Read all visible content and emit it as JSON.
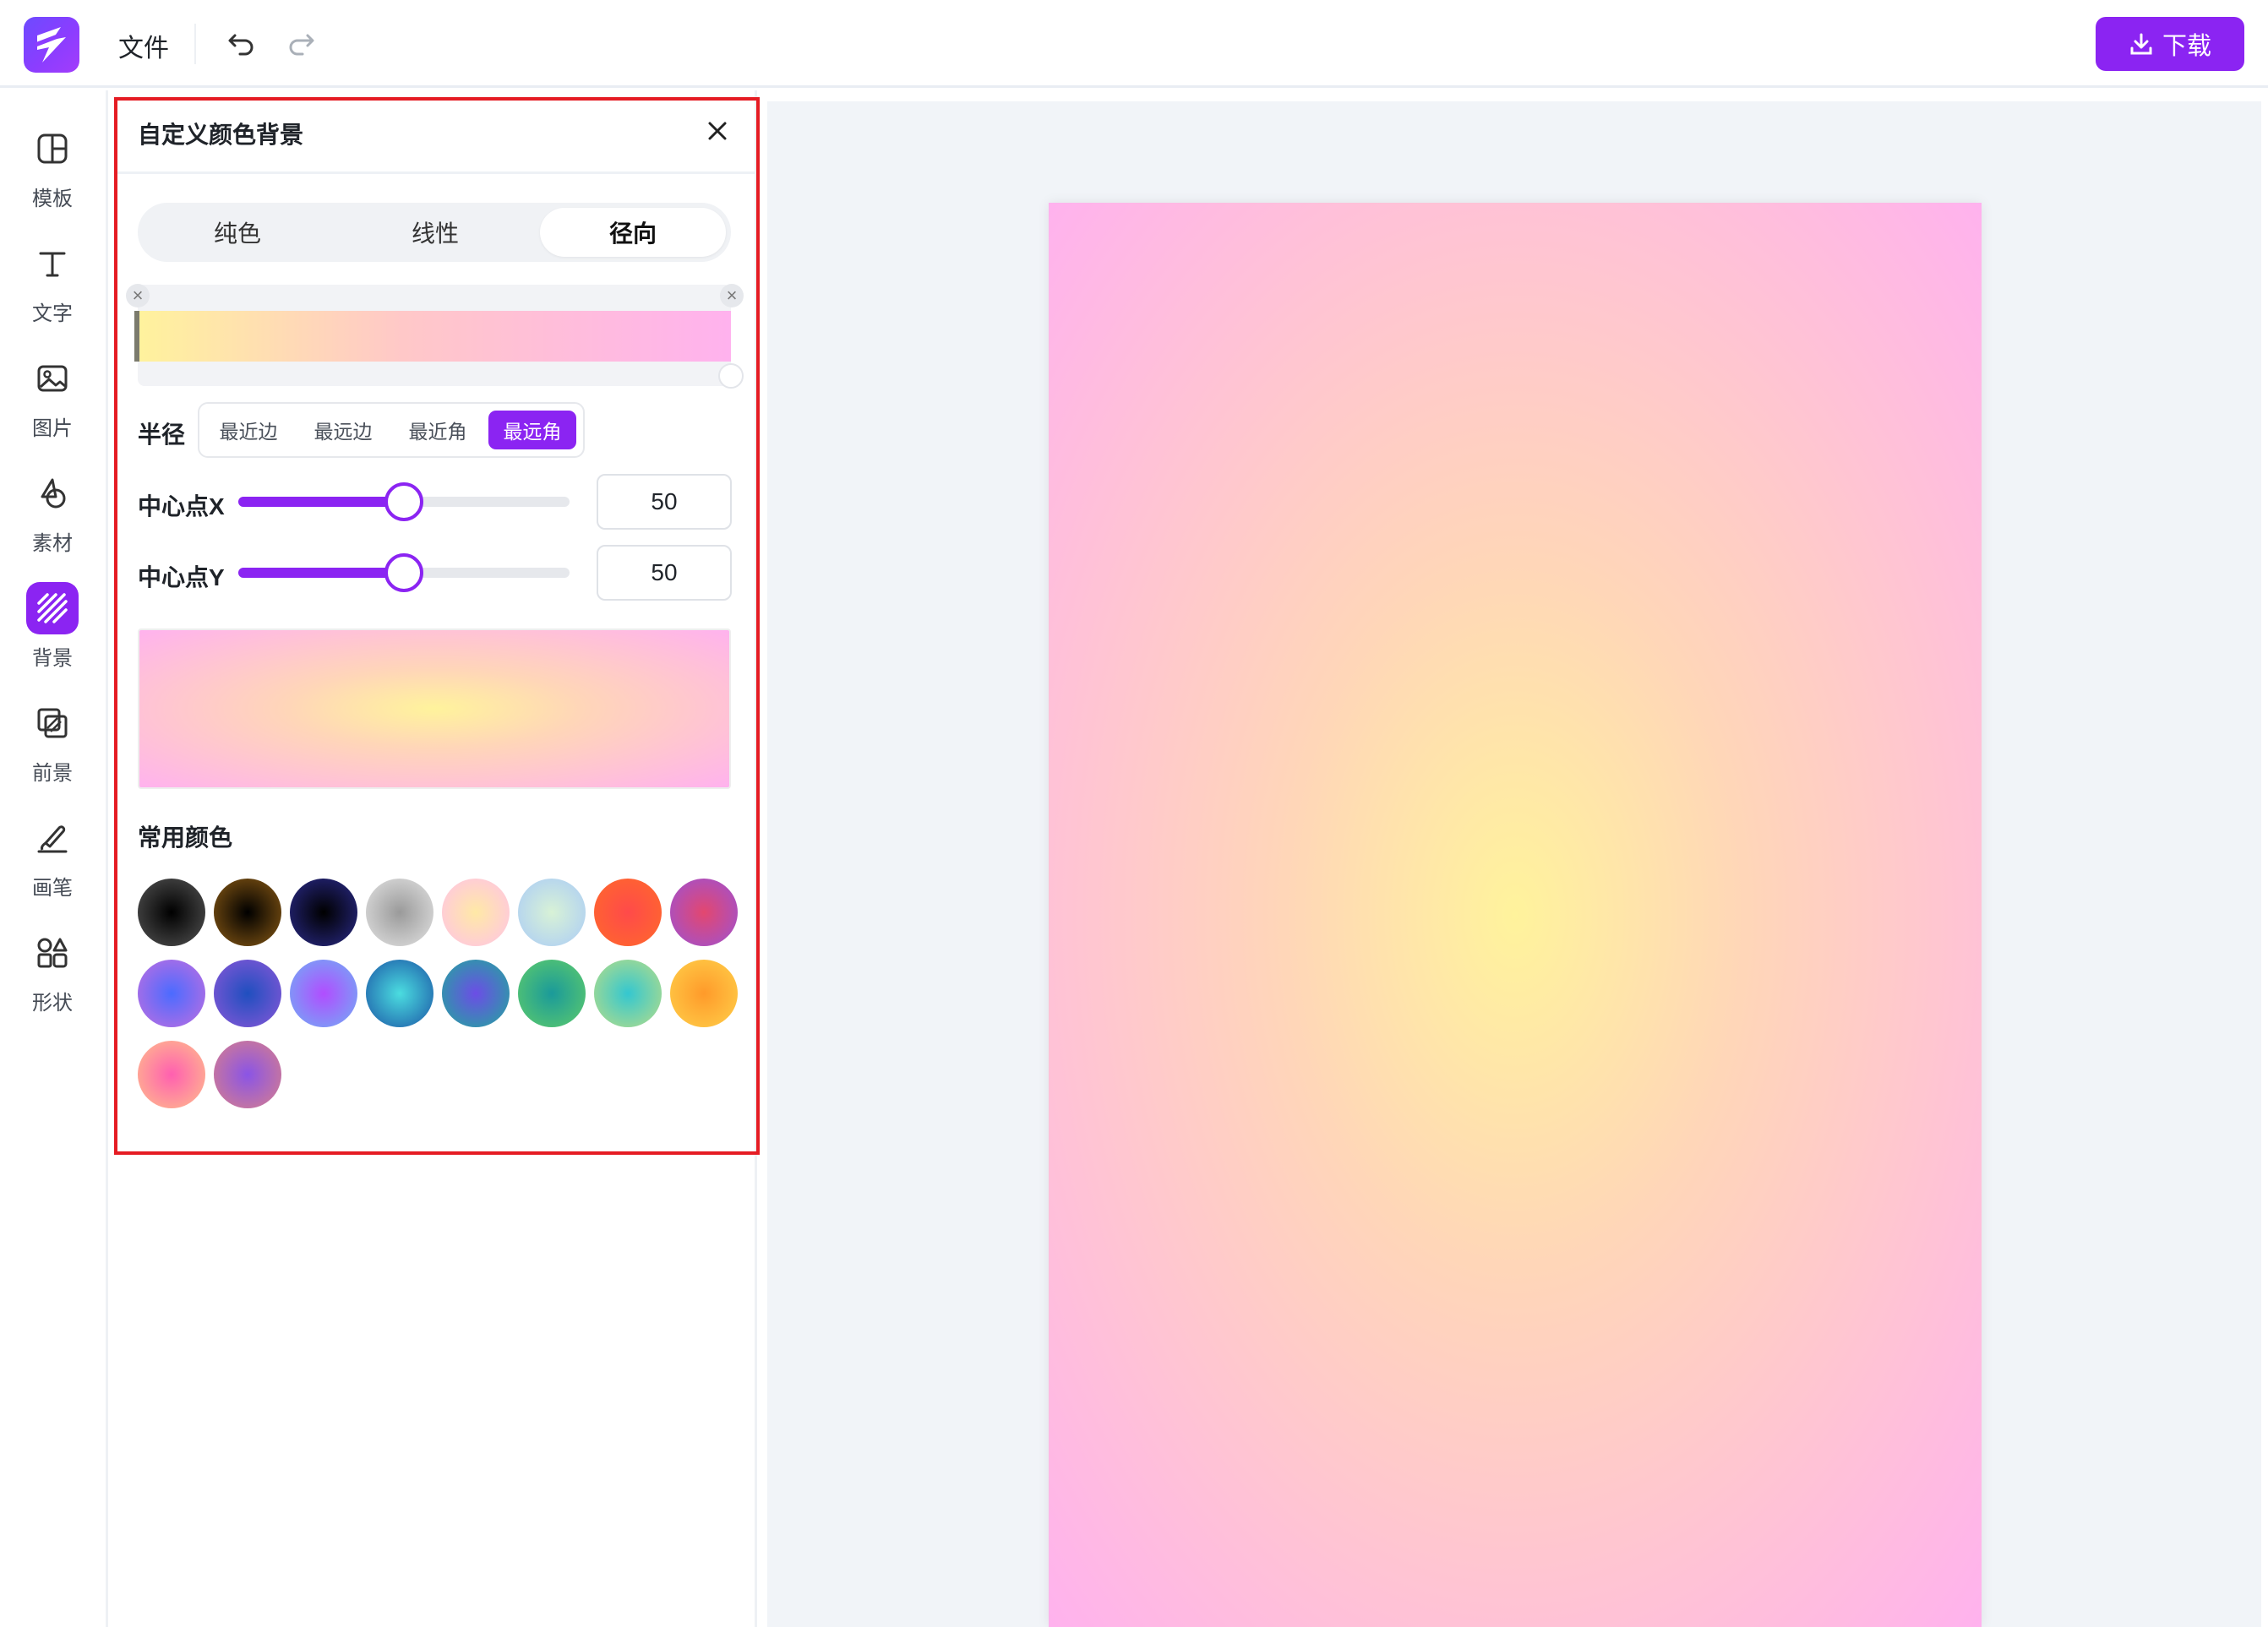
{
  "topbar": {
    "file_menu": "文件",
    "download_label": "下载",
    "brand_color": "#8b24f2"
  },
  "rail": {
    "items": [
      {
        "label": "模板",
        "icon": "layout-icon"
      },
      {
        "label": "文字",
        "icon": "text-icon"
      },
      {
        "label": "图片",
        "icon": "image-icon"
      },
      {
        "label": "素材",
        "icon": "shapes-material-icon"
      },
      {
        "label": "背景",
        "icon": "background-hatch-icon",
        "active": true
      },
      {
        "label": "前景",
        "icon": "foreground-icon"
      },
      {
        "label": "画笔",
        "icon": "brush-icon"
      },
      {
        "label": "形状",
        "icon": "shape-icon"
      }
    ]
  },
  "panel": {
    "title": "自定义颜色背景",
    "tabs": [
      "纯色",
      "线性",
      "径向"
    ],
    "active_tab": "径向",
    "gradient_stops": [
      "#fff39c",
      "#ffb2ee"
    ],
    "radius": {
      "label": "半径",
      "options": [
        "最近边",
        "最远边",
        "最近角",
        "最远角"
      ],
      "selected": "最远角"
    },
    "center_x": {
      "label": "中心点X",
      "value": "50",
      "fraction": 0.5
    },
    "center_y": {
      "label": "中心点Y",
      "value": "50",
      "fraction": 0.5
    },
    "common_colors_label": "常用颜色",
    "swatches": [
      [
        "#000000",
        "#555555"
      ],
      [
        "#000000",
        "#8a5a14"
      ],
      [
        "#000000",
        "#2a2a8a"
      ],
      [
        "#9a9a9a",
        "#e3e3e3"
      ],
      [
        "#ffe9a6",
        "#ffc2e8"
      ],
      [
        "#d8f2d6",
        "#aacbf7"
      ],
      [
        "#ff4a4a",
        "#ff6a2a"
      ],
      [
        "#e3476f",
        "#9b52d6"
      ],
      [
        "#4b6bff",
        "#c26ee0"
      ],
      [
        "#1f4fbf",
        "#8a57d8"
      ],
      [
        "#b14dff",
        "#6fb0f5"
      ],
      [
        "#4bdde0",
        "#1b55a6"
      ],
      [
        "#6c4de6",
        "#1faa9a"
      ],
      [
        "#1a9a9a",
        "#5fcc6a"
      ],
      [
        "#34c7d0",
        "#b9dd86"
      ],
      [
        "#ff9a2a",
        "#ffd04a"
      ],
      [
        "#ff5fb0",
        "#ffc08a"
      ],
      [
        "#8a54e6",
        "#d9808a"
      ]
    ]
  }
}
